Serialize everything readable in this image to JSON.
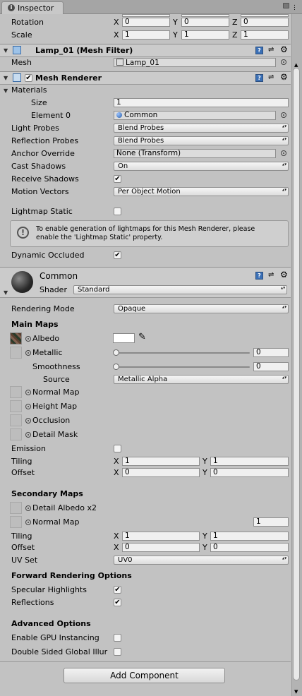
{
  "tab": {
    "title": "Inspector"
  },
  "transform": {
    "rotation_label": "Rotation",
    "rotation": {
      "x": "0",
      "y": "0",
      "z": "0"
    },
    "scale_label": "Scale",
    "scale": {
      "x": "1",
      "y": "1",
      "z": "1"
    },
    "axis": {
      "x": "X",
      "y": "Y",
      "z": "Z"
    }
  },
  "mesh_filter": {
    "title": "Lamp_01 (Mesh Filter)",
    "mesh_label": "Mesh",
    "mesh_value": "Lamp_01"
  },
  "mesh_renderer": {
    "title": "Mesh Renderer",
    "materials_label": "Materials",
    "size_label": "Size",
    "size_value": "1",
    "element0_label": "Element 0",
    "element0_value": "Common",
    "light_probes_label": "Light Probes",
    "light_probes_value": "Blend Probes",
    "reflection_probes_label": "Reflection Probes",
    "reflection_probes_value": "Blend Probes",
    "anchor_override_label": "Anchor Override",
    "anchor_override_value": "None (Transform)",
    "cast_shadows_label": "Cast Shadows",
    "cast_shadows_value": "On",
    "receive_shadows_label": "Receive Shadows",
    "receive_shadows_checked": true,
    "motion_vectors_label": "Motion Vectors",
    "motion_vectors_value": "Per Object Motion",
    "lightmap_static_label": "Lightmap Static",
    "lightmap_static_checked": false,
    "help_text_1": "To enable generation of lightmaps for this Mesh Renderer, please",
    "help_text_2": "enable the 'Lightmap Static' property.",
    "dynamic_occluded_label": "Dynamic Occluded",
    "dynamic_occluded_checked": true
  },
  "material": {
    "name": "Common",
    "shader_label": "Shader",
    "shader_value": "Standard",
    "rendering_mode_label": "Rendering Mode",
    "rendering_mode_value": "Opaque",
    "main_maps_label": "Main Maps",
    "albedo_label": "Albedo",
    "metallic_label": "Metallic",
    "metallic_value": "0",
    "metallic_level": 0,
    "smoothness_label": "Smoothness",
    "smoothness_value": "0",
    "smoothness_level": 0,
    "source_label": "Source",
    "source_value": "Metallic Alpha",
    "normal_map_label": "Normal Map",
    "height_map_label": "Height Map",
    "occlusion_label": "Occlusion",
    "detail_mask_label": "Detail Mask",
    "emission_label": "Emission",
    "emission_checked": false,
    "tiling_label": "Tiling",
    "tiling": {
      "x": "1",
      "y": "1"
    },
    "offset_label": "Offset",
    "offset": {
      "x": "0",
      "y": "0"
    },
    "secondary_maps_label": "Secondary Maps",
    "detail_albedo_label": "Detail Albedo x2",
    "secondary_normal_label": "Normal Map",
    "secondary_normal_value": "1",
    "tiling2": {
      "x": "1",
      "y": "1"
    },
    "offset2": {
      "x": "0",
      "y": "0"
    },
    "uv_set_label": "UV Set",
    "uv_set_value": "UV0",
    "forward_label": "Forward Rendering Options",
    "specular_label": "Specular Highlights",
    "specular_checked": true,
    "reflections_label": "Reflections",
    "reflections_checked": true,
    "advanced_label": "Advanced Options",
    "gpu_instancing_label": "Enable GPU Instancing",
    "gpu_instancing_checked": false,
    "double_sided_label": "Double Sided Global Illur",
    "double_sided_checked": false
  },
  "add_component_label": "Add Component",
  "check_glyph": "✔"
}
